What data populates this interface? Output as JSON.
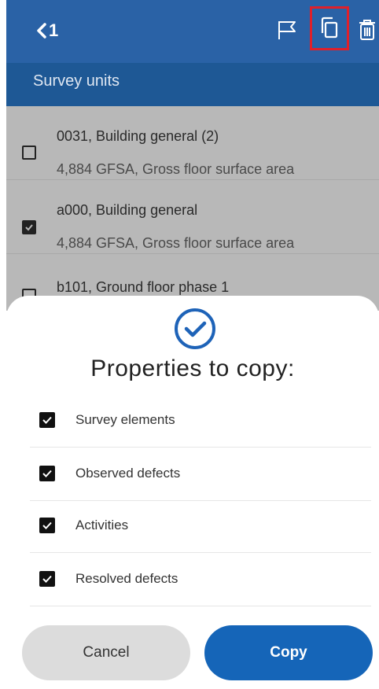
{
  "header": {
    "back_label": "1",
    "icons": [
      "chevron-left-icon",
      "flag-icon",
      "copy-icon",
      "trash-icon"
    ]
  },
  "section": {
    "title": "Survey units"
  },
  "units": [
    {
      "name": "0031, Building general (2)",
      "meta": "4,884 GFSA, Gross floor surface area",
      "checked": false
    },
    {
      "name": "a000, Building general",
      "meta": "4,884 GFSA, Gross floor surface area",
      "checked": true
    },
    {
      "name": "b101, Ground floor phase 1",
      "meta": "",
      "checked": false
    }
  ],
  "sheet": {
    "title": "Properties to copy:",
    "properties": [
      {
        "label": "Survey elements",
        "checked": true
      },
      {
        "label": "Observed defects",
        "checked": true
      },
      {
        "label": "Activities",
        "checked": true
      },
      {
        "label": "Resolved defects",
        "checked": true
      }
    ],
    "cancel_label": "Cancel",
    "copy_label": "Copy"
  },
  "colors": {
    "header": "#2a62a6",
    "subheader": "#1e5895",
    "primary_button": "#1565b8",
    "highlight": "#e0202a"
  }
}
